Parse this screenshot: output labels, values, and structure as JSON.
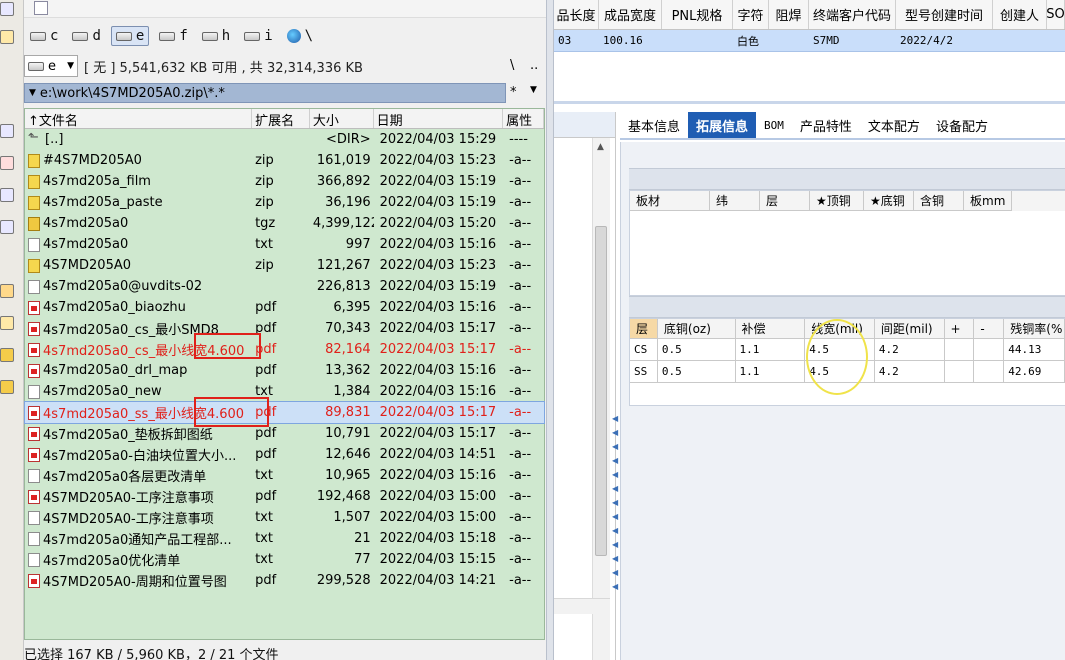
{
  "file_manager": {
    "drives": [
      {
        "letter": "c",
        "icon": "hard-drive-icon",
        "active": false
      },
      {
        "letter": "d",
        "icon": "hard-drive-icon",
        "active": false
      },
      {
        "letter": "e",
        "icon": "hard-drive-icon",
        "active": true
      },
      {
        "letter": "f",
        "icon": "hard-drive-icon",
        "active": false
      },
      {
        "letter": "h",
        "icon": "hard-drive-icon",
        "active": false
      },
      {
        "letter": "i",
        "icon": "hard-drive-icon",
        "active": false
      },
      {
        "letter": "\\",
        "icon": "network-icon",
        "active": false
      }
    ],
    "drive_select_value": "e",
    "free_space_text": "[ 无 ]  5,541,632 KB 可用 , 共 32,314,336 KB",
    "root_button": "\\",
    "up_button": "..",
    "path": "e:\\work\\4S7MD205A0.zip\\*.*",
    "filter_button": "*",
    "columns": {
      "name": "文件名",
      "ext": "扩展名",
      "size": "大小",
      "date": "日期",
      "attr": "属性"
    },
    "files": [
      {
        "name": "[..]",
        "ext": "",
        "size": "<DIR>",
        "date": "2022/04/03 15:29",
        "attr": "----",
        "icon": "up",
        "style": ""
      },
      {
        "name": "#4S7MD205A0",
        "ext": "zip",
        "size": "161,019",
        "date": "2022/04/03 15:23",
        "attr": "-a--",
        "icon": "zip",
        "style": ""
      },
      {
        "name": "4s7md205a_film",
        "ext": "zip",
        "size": "366,892",
        "date": "2022/04/03 15:19",
        "attr": "-a--",
        "icon": "zip",
        "style": ""
      },
      {
        "name": "4s7md205a_paste",
        "ext": "zip",
        "size": "36,196",
        "date": "2022/04/03 15:19",
        "attr": "-a--",
        "icon": "zip",
        "style": ""
      },
      {
        "name": "4s7md205a0",
        "ext": "tgz",
        "size": "4,399,122",
        "date": "2022/04/03 15:20",
        "attr": "-a--",
        "icon": "tgz",
        "style": ""
      },
      {
        "name": "4s7md205a0",
        "ext": "txt",
        "size": "997",
        "date": "2022/04/03 15:16",
        "attr": "-a--",
        "icon": "txt",
        "style": ""
      },
      {
        "name": "4S7MD205A0",
        "ext": "zip",
        "size": "121,267",
        "date": "2022/04/03 15:23",
        "attr": "-a--",
        "icon": "zip",
        "style": ""
      },
      {
        "name": "4s7md205a0@uvdits-02",
        "ext": "",
        "size": "226,813",
        "date": "2022/04/03 15:19",
        "attr": "-a--",
        "icon": "txt",
        "style": ""
      },
      {
        "name": "4s7md205a0_biaozhu",
        "ext": "pdf",
        "size": "6,395",
        "date": "2022/04/03 15:16",
        "attr": "-a--",
        "icon": "pdf",
        "style": ""
      },
      {
        "name": "4s7md205a0_cs_最小SMD8",
        "ext": "pdf",
        "size": "70,343",
        "date": "2022/04/03 15:17",
        "attr": "-a--",
        "icon": "pdf",
        "style": ""
      },
      {
        "name": "4s7md205a0_cs_最小线宽4.600",
        "ext": "pdf",
        "size": "82,164",
        "date": "2022/04/03 15:17",
        "attr": "-a--",
        "icon": "pdf",
        "style": "red"
      },
      {
        "name": "4s7md205a0_drl_map",
        "ext": "pdf",
        "size": "13,362",
        "date": "2022/04/03 15:16",
        "attr": "-a--",
        "icon": "pdf",
        "style": ""
      },
      {
        "name": "4s7md205a0_new",
        "ext": "txt",
        "size": "1,384",
        "date": "2022/04/03 15:16",
        "attr": "-a--",
        "icon": "txt",
        "style": ""
      },
      {
        "name": "4s7md205a0_ss_最小线宽4.600",
        "ext": "pdf",
        "size": "89,831",
        "date": "2022/04/03 15:17",
        "attr": "-a--",
        "icon": "pdf",
        "style": "red selected"
      },
      {
        "name": "4s7md205a0_垫板拆卸图纸",
        "ext": "pdf",
        "size": "10,791",
        "date": "2022/04/03 15:17",
        "attr": "-a--",
        "icon": "pdf",
        "style": ""
      },
      {
        "name": "4s7md205a0-白油块位置大小...",
        "ext": "pdf",
        "size": "12,646",
        "date": "2022/04/03 14:51",
        "attr": "-a--",
        "icon": "pdf",
        "style": ""
      },
      {
        "name": "4s7md205a0各层更改清单",
        "ext": "txt",
        "size": "10,965",
        "date": "2022/04/03 15:16",
        "attr": "-a--",
        "icon": "txt",
        "style": ""
      },
      {
        "name": "4S7MD205A0-工序注意事项",
        "ext": "pdf",
        "size": "192,468",
        "date": "2022/04/03 15:00",
        "attr": "-a--",
        "icon": "pdf",
        "style": ""
      },
      {
        "name": "4S7MD205A0-工序注意事项",
        "ext": "txt",
        "size": "1,507",
        "date": "2022/04/03 15:00",
        "attr": "-a--",
        "icon": "txt",
        "style": ""
      },
      {
        "name": "4s7md205a0通知产品工程部...",
        "ext": "txt",
        "size": "21",
        "date": "2022/04/03 15:18",
        "attr": "-a--",
        "icon": "txt",
        "style": ""
      },
      {
        "name": "4s7md205a0优化清单",
        "ext": "txt",
        "size": "77",
        "date": "2022/04/03 15:15",
        "attr": "-a--",
        "icon": "txt",
        "style": ""
      },
      {
        "name": "4S7MD205A0-周期和位置号图",
        "ext": "pdf",
        "size": "299,528",
        "date": "2022/04/03 14:21",
        "attr": "-a--",
        "icon": "pdf",
        "style": ""
      }
    ],
    "status": "已选择 167 KB / 5,960 KB，2 / 21 个文件",
    "colors": {
      "list_bg": "#cfe8cf",
      "highlight_red": "#e0201a",
      "path_bg": "#a3b7d3"
    }
  },
  "erp": {
    "grid_columns": [
      "品长度",
      "成品宽度",
      "PNL规格",
      "字符",
      "阻焊",
      "终端客户代码",
      "型号创建时间",
      "创建人",
      "SO"
    ],
    "grid_row": [
      "03",
      "100.16",
      "",
      "白色",
      "",
      "S7MD",
      "2022/4/2",
      "",
      ""
    ],
    "tabs": [
      {
        "label": "基本信息",
        "active": false,
        "small": false
      },
      {
        "label": "拓展信息",
        "active": true,
        "small": false
      },
      {
        "label": "BOM",
        "active": false,
        "small": true
      },
      {
        "label": "产品特性",
        "active": false,
        "small": false
      },
      {
        "label": "文本配方",
        "active": false,
        "small": false
      },
      {
        "label": "设备配方",
        "active": false,
        "small": false
      }
    ],
    "material_columns": [
      "板材",
      "纬",
      "层",
      "★顶铜",
      "★底铜",
      "含铜",
      "板mm"
    ],
    "layer_columns": [
      "层",
      "底铜(oz)",
      "补偿",
      "线宽(mil)",
      "间距(mil)",
      "+",
      "-",
      "残铜率(%"
    ],
    "layer_rows": [
      [
        "CS",
        "0.5",
        "1.1",
        "4.5",
        "4.2",
        "",
        "",
        "44.13"
      ],
      [
        "SS",
        "0.5",
        "1.1",
        "4.5",
        "4.2",
        "",
        "",
        "42.69"
      ]
    ],
    "colors": {
      "active_tab": "#1f5db3",
      "selected_row": "#c9defa",
      "annotation_ellipse": "#f0e34a"
    }
  }
}
